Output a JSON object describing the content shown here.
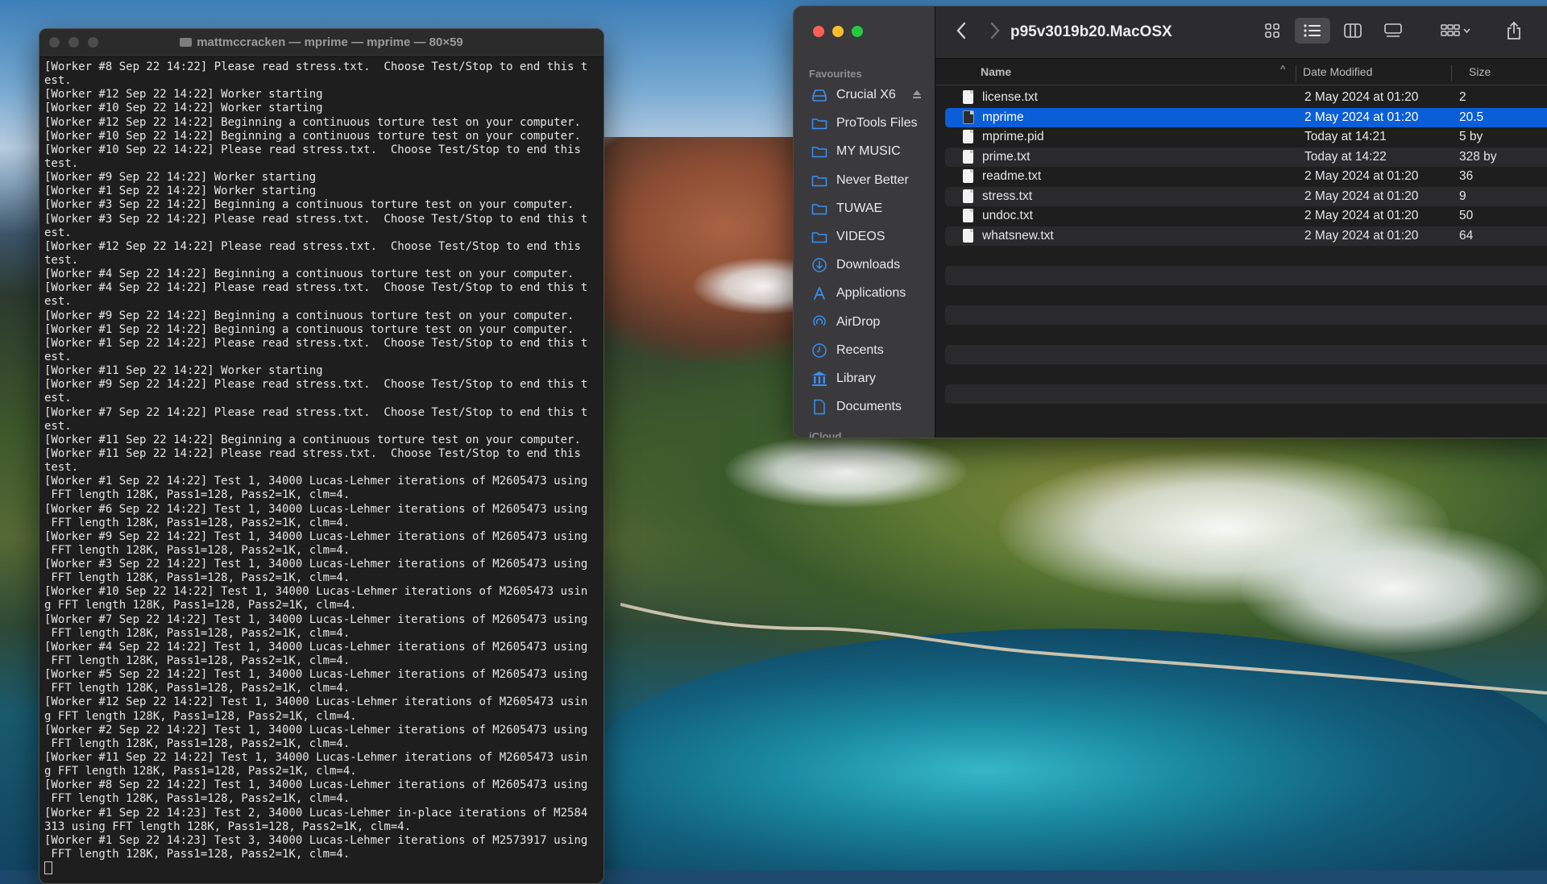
{
  "terminal": {
    "title": "mattmccracken — mprime — mprime — 80×59",
    "lines": [
      "[Worker #8 Sep 22 14:22] Please read stress.txt.  Choose Test/Stop to end this t",
      "est.",
      "[Worker #12 Sep 22 14:22] Worker starting",
      "[Worker #10 Sep 22 14:22] Worker starting",
      "[Worker #12 Sep 22 14:22] Beginning a continuous torture test on your computer.",
      "[Worker #10 Sep 22 14:22] Beginning a continuous torture test on your computer.",
      "[Worker #10 Sep 22 14:22] Please read stress.txt.  Choose Test/Stop to end this",
      "test.",
      "[Worker #9 Sep 22 14:22] Worker starting",
      "[Worker #1 Sep 22 14:22] Worker starting",
      "[Worker #3 Sep 22 14:22] Beginning a continuous torture test on your computer.",
      "[Worker #3 Sep 22 14:22] Please read stress.txt.  Choose Test/Stop to end this t",
      "est.",
      "[Worker #12 Sep 22 14:22] Please read stress.txt.  Choose Test/Stop to end this",
      "test.",
      "[Worker #4 Sep 22 14:22] Beginning a continuous torture test on your computer.",
      "[Worker #4 Sep 22 14:22] Please read stress.txt.  Choose Test/Stop to end this t",
      "est.",
      "[Worker #9 Sep 22 14:22] Beginning a continuous torture test on your computer.",
      "[Worker #1 Sep 22 14:22] Beginning a continuous torture test on your computer.",
      "[Worker #1 Sep 22 14:22] Please read stress.txt.  Choose Test/Stop to end this t",
      "est.",
      "[Worker #11 Sep 22 14:22] Worker starting",
      "[Worker #9 Sep 22 14:22] Please read stress.txt.  Choose Test/Stop to end this t",
      "est.",
      "[Worker #7 Sep 22 14:22] Please read stress.txt.  Choose Test/Stop to end this t",
      "est.",
      "[Worker #11 Sep 22 14:22] Beginning a continuous torture test on your computer.",
      "[Worker #11 Sep 22 14:22] Please read stress.txt.  Choose Test/Stop to end this",
      "test.",
      "[Worker #1 Sep 22 14:22] Test 1, 34000 Lucas-Lehmer iterations of M2605473 using",
      " FFT length 128K, Pass1=128, Pass2=1K, clm=4.",
      "[Worker #6 Sep 22 14:22] Test 1, 34000 Lucas-Lehmer iterations of M2605473 using",
      " FFT length 128K, Pass1=128, Pass2=1K, clm=4.",
      "[Worker #9 Sep 22 14:22] Test 1, 34000 Lucas-Lehmer iterations of M2605473 using",
      " FFT length 128K, Pass1=128, Pass2=1K, clm=4.",
      "[Worker #3 Sep 22 14:22] Test 1, 34000 Lucas-Lehmer iterations of M2605473 using",
      " FFT length 128K, Pass1=128, Pass2=1K, clm=4.",
      "[Worker #10 Sep 22 14:22] Test 1, 34000 Lucas-Lehmer iterations of M2605473 usin",
      "g FFT length 128K, Pass1=128, Pass2=1K, clm=4.",
      "[Worker #7 Sep 22 14:22] Test 1, 34000 Lucas-Lehmer iterations of M2605473 using",
      " FFT length 128K, Pass1=128, Pass2=1K, clm=4.",
      "[Worker #4 Sep 22 14:22] Test 1, 34000 Lucas-Lehmer iterations of M2605473 using",
      " FFT length 128K, Pass1=128, Pass2=1K, clm=4.",
      "[Worker #5 Sep 22 14:22] Test 1, 34000 Lucas-Lehmer iterations of M2605473 using",
      " FFT length 128K, Pass1=128, Pass2=1K, clm=4.",
      "[Worker #12 Sep 22 14:22] Test 1, 34000 Lucas-Lehmer iterations of M2605473 usin",
      "g FFT length 128K, Pass1=128, Pass2=1K, clm=4.",
      "[Worker #2 Sep 22 14:22] Test 1, 34000 Lucas-Lehmer iterations of M2605473 using",
      " FFT length 128K, Pass1=128, Pass2=1K, clm=4.",
      "[Worker #11 Sep 22 14:22] Test 1, 34000 Lucas-Lehmer iterations of M2605473 usin",
      "g FFT length 128K, Pass1=128, Pass2=1K, clm=4.",
      "[Worker #8 Sep 22 14:22] Test 1, 34000 Lucas-Lehmer iterations of M2605473 using",
      " FFT length 128K, Pass1=128, Pass2=1K, clm=4.",
      "[Worker #1 Sep 22 14:23] Test 2, 34000 Lucas-Lehmer in-place iterations of M2584",
      "313 using FFT length 128K, Pass1=128, Pass2=1K, clm=4.",
      "[Worker #1 Sep 22 14:23] Test 3, 34000 Lucas-Lehmer iterations of M2573917 using",
      " FFT length 128K, Pass1=128, Pass2=1K, clm=4."
    ]
  },
  "finder": {
    "title": "p95v3019b20.MacOSX",
    "sidebar": {
      "favourites_heading": "Favourites",
      "icloud_heading": "iCloud",
      "items": [
        {
          "label": "Crucial X6",
          "icon": "external-drive-icon"
        },
        {
          "label": "ProTools Files",
          "icon": "folder-icon"
        },
        {
          "label": "MY MUSIC",
          "icon": "folder-icon"
        },
        {
          "label": "Never Better",
          "icon": "folder-icon"
        },
        {
          "label": "TUWAE",
          "icon": "folder-icon"
        },
        {
          "label": "VIDEOS",
          "icon": "folder-icon"
        },
        {
          "label": "Downloads",
          "icon": "downloads-icon"
        },
        {
          "label": "Applications",
          "icon": "applications-icon"
        },
        {
          "label": "AirDrop",
          "icon": "airdrop-icon"
        },
        {
          "label": "Recents",
          "icon": "clock-icon"
        },
        {
          "label": "Library",
          "icon": "library-icon"
        },
        {
          "label": "Documents",
          "icon": "document-icon"
        }
      ]
    },
    "columns": {
      "name": "Name",
      "date": "Date Modified",
      "size": "Size"
    },
    "files": [
      {
        "name": "license.txt",
        "date": "2 May 2024 at 01:20",
        "size": "2",
        "kind": "text"
      },
      {
        "name": "mprime",
        "date": "2 May 2024 at 01:20",
        "size": "20.5",
        "kind": "exec",
        "selected": true
      },
      {
        "name": "mprime.pid",
        "date": "Today at 14:21",
        "size": "5 by",
        "kind": "text"
      },
      {
        "name": "prime.txt",
        "date": "Today at 14:22",
        "size": "328 by",
        "kind": "text"
      },
      {
        "name": "readme.txt",
        "date": "2 May 2024 at 01:20",
        "size": "36",
        "kind": "text"
      },
      {
        "name": "stress.txt",
        "date": "2 May 2024 at 01:20",
        "size": "9",
        "kind": "text"
      },
      {
        "name": "undoc.txt",
        "date": "2 May 2024 at 01:20",
        "size": "50",
        "kind": "text"
      },
      {
        "name": "whatsnew.txt",
        "date": "2 May 2024 at 01:20",
        "size": "64",
        "kind": "text"
      }
    ],
    "colors": {
      "selection": "#0a5ed8",
      "accent": "#3b8ff0"
    }
  }
}
